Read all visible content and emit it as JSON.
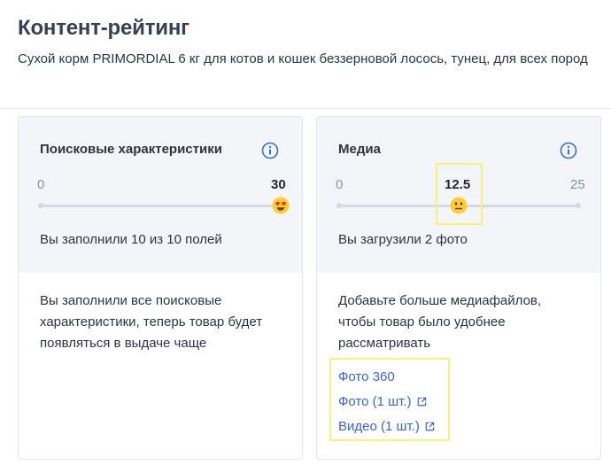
{
  "header": {
    "title": "Контент-рейтинг",
    "subtitle": "Сухой корм PRIMORDIAL 6 кг для котов и кошек беззерновой лосось, тунец, для всех пород"
  },
  "cards": [
    {
      "title": "Поисковые характеристики",
      "scale_min": "0",
      "scale_max": "30",
      "value": "30",
      "level": 1.0,
      "marker_emoji": "heart-eyes-face-icon",
      "note": "Вы заполнили 10 из 10 полей",
      "body": "Вы заполнили все поисковые характеристики, теперь товар будет появляться в выдаче чаще"
    },
    {
      "title": "Медиа",
      "scale_min": "0",
      "scale_max": "25",
      "value": "12.5",
      "level": 0.5,
      "marker_emoji": "neutral-face-icon",
      "note": "Вы загрузили 2 фото",
      "body": "Добавьте больше медиафайлов, чтобы товар было удобнее рассматривать",
      "links": [
        {
          "label": "Фото 360",
          "external": false
        },
        {
          "label": "Фото (1 шт.)",
          "external": true
        },
        {
          "label": "Видео (1 шт.)",
          "external": true
        }
      ]
    }
  ],
  "colors": {
    "link": "#3a63d4",
    "info": "#2f6fe0",
    "highlight": "#f4f27a",
    "panel": "#f3f5f9"
  }
}
